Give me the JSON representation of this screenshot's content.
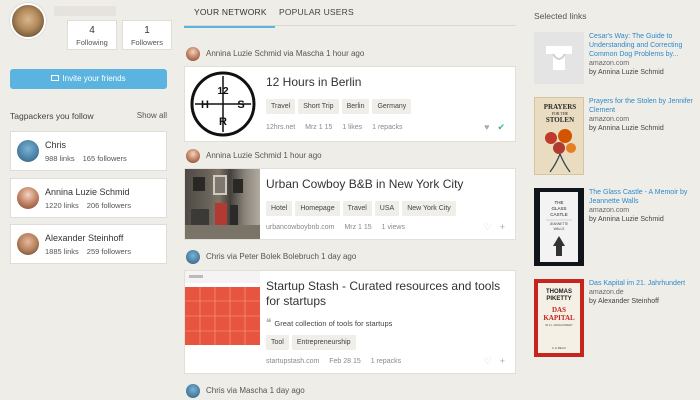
{
  "profile": {
    "following_count": "4",
    "following_label": "Following",
    "followers_count": "1",
    "followers_label": "Followers"
  },
  "invite_label": "Invite your friends",
  "tagpackers": {
    "heading": "Tagpackers you follow",
    "show_all": "Show all",
    "people": [
      {
        "name": "Chris",
        "links": "988 links",
        "followers": "165 followers"
      },
      {
        "name": "Annina Luzie Schmid",
        "links": "1220 links",
        "followers": "206 followers"
      },
      {
        "name": "Alexander Steinhoff",
        "links": "1885 links",
        "followers": "259 followers"
      }
    ]
  },
  "tabs": {
    "network": "YOUR NETWORK",
    "popular": "POPULAR USERS"
  },
  "feed": [
    {
      "byline": "Annina Luzie Schmid via Mascha 1 hour ago",
      "title": "12 Hours in Berlin",
      "tags": [
        "Travel",
        "Short Trip",
        "Berlin",
        "Germany"
      ],
      "domain": "12hrs.net",
      "date": "Mrz 1 15",
      "likes": "1 likes",
      "repacks": "1 repacks"
    },
    {
      "byline": "Annina Luzie Schmid 1 hour ago",
      "title": "Urban Cowboy B&B in New York City",
      "tags": [
        "Hotel",
        "Homepage",
        "Travel",
        "USA",
        "New York City"
      ],
      "domain": "urbancowboybnb.com",
      "date": "Mrz 1 15",
      "views": "1 views"
    },
    {
      "byline": "Chris via Peter Bolek Bolebruch 1 day ago",
      "title": "Startup Stash - Curated resources and tools for startups",
      "quote": "Great collection of tools for startups",
      "tags": [
        "Tool",
        "Entrepreneurship"
      ],
      "domain": "startupstash.com",
      "date": "Feb 28 15",
      "repacks": "1 repacks"
    },
    {
      "byline": "Chris via Mascha 1 day ago"
    }
  ],
  "berlin_logo": {
    "top": "12",
    "left": "H",
    "right": "S",
    "bottom": "R"
  },
  "selected": {
    "heading": "Selected links",
    "items": [
      {
        "title": "Cesar's Way: The Guide to Understanding and Correcting Common Dog Problems by...",
        "source": "amazon.com",
        "by": "by Annina Luzie Schmid"
      },
      {
        "title": "Prayers for the Stolen by Jennifer Clement",
        "source": "amazon.com",
        "by": "by Annina Luzie Schmid"
      },
      {
        "title": "The Glass Castle - A Memoir by Jeannette Walls",
        "source": "amazon.com",
        "by": "by Annina Luzie Schmid"
      },
      {
        "title": "Das Kapital im 21. Jahrhundert",
        "source": "amazon.de",
        "by": "by Alexander Steinhoff"
      }
    ]
  },
  "book_covers": {
    "prayers": [
      "PRAYERS",
      "FOR THE",
      "STOLEN"
    ],
    "glass": [
      "THE",
      "GLASS",
      "CASTLE",
      "JEANNETTE",
      "WALLS"
    ],
    "kapital": [
      "THOMAS",
      "PIKETTY",
      "DAS",
      "KAPITAL",
      "IM 21. JAHRHUNDERT",
      "C.H.BECK"
    ]
  },
  "colors": {
    "accent": "#5bb4e0",
    "link": "#2d8ac9",
    "check": "#3cb878"
  }
}
